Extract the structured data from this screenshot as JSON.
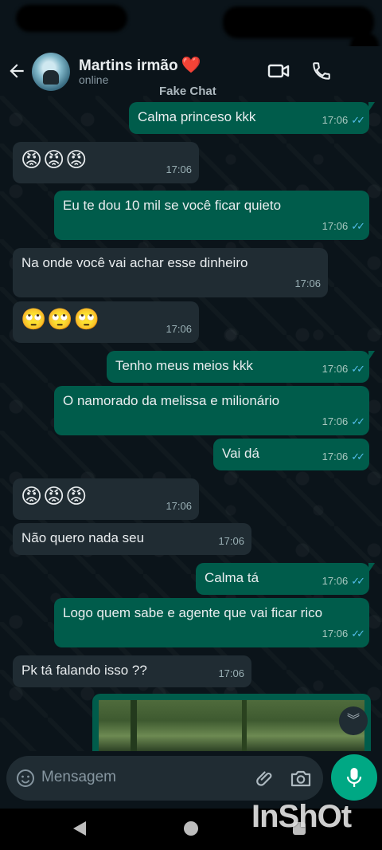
{
  "header": {
    "contact_name": "Martins irmão",
    "heart": "❤️",
    "status": "online",
    "icons": [
      "back-arrow-icon",
      "video-call-icon",
      "phone-icon"
    ]
  },
  "watermark_top": "Fake Chat",
  "watermark_bottom": "InShOt",
  "messages": [
    {
      "dir": "out",
      "text": "Calma princeso kkk",
      "time": "17:06",
      "read": true
    },
    {
      "dir": "in",
      "emoji": "😡😡😡",
      "time": "17:06"
    },
    {
      "dir": "out",
      "text": "Eu te dou 10 mil se você ficar quieto",
      "time": "17:06",
      "read": true
    },
    {
      "dir": "in",
      "text": "Na onde você vai achar esse dinheiro",
      "time": "17:06"
    },
    {
      "dir": "in",
      "emoji": "🙄🙄🙄",
      "time": "17:06"
    },
    {
      "dir": "out",
      "text": "Tenho meus meios kkk",
      "time": "17:06",
      "read": true
    },
    {
      "dir": "out",
      "text": "O namorado da melissa e milionário",
      "time": "17:06",
      "read": true
    },
    {
      "dir": "out",
      "text": "Vai dá",
      "time": "17:06",
      "read": true
    },
    {
      "dir": "in",
      "emoji": "😡😡😡",
      "time": "17:06"
    },
    {
      "dir": "in",
      "text": "Não quero nada seu",
      "time": "17:06"
    },
    {
      "dir": "out",
      "text": "Calma tá",
      "time": "17:06",
      "read": true
    },
    {
      "dir": "out",
      "text": "Logo quem sabe e agente que vai ficar rico",
      "time": "17:06",
      "read": true
    },
    {
      "dir": "in",
      "text": "Pk tá falando isso ??",
      "time": "17:06"
    }
  ],
  "composer": {
    "placeholder": "Mensagem",
    "icons": [
      "emoji-icon",
      "attach-icon",
      "camera-icon",
      "mic-icon"
    ]
  },
  "ticks": "✓✓"
}
